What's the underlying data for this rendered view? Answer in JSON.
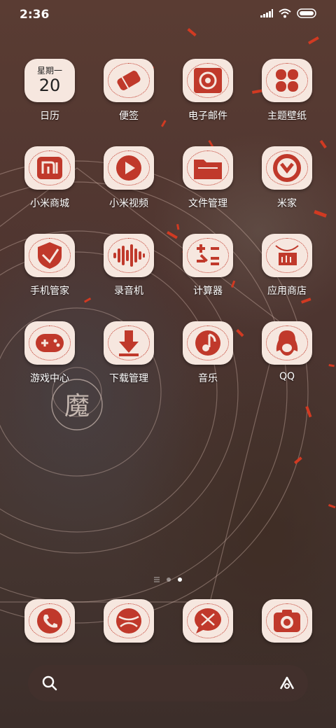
{
  "status": {
    "time": "2:36"
  },
  "calendar": {
    "weekday": "星期一",
    "day": "20"
  },
  "apps": [
    {
      "label": "日历",
      "icon": "calendar-icon"
    },
    {
      "label": "便签",
      "icon": "notes-icon"
    },
    {
      "label": "电子邮件",
      "icon": "email-icon"
    },
    {
      "label": "主题壁纸",
      "icon": "themes-icon"
    },
    {
      "label": "小米商城",
      "icon": "mi-store-icon"
    },
    {
      "label": "小米视频",
      "icon": "video-icon"
    },
    {
      "label": "文件管理",
      "icon": "file-manager-icon"
    },
    {
      "label": "米家",
      "icon": "mijia-icon"
    },
    {
      "label": "手机管家",
      "icon": "security-icon"
    },
    {
      "label": "录音机",
      "icon": "recorder-icon"
    },
    {
      "label": "计算器",
      "icon": "calculator-icon"
    },
    {
      "label": "应用商店",
      "icon": "app-store-icon"
    },
    {
      "label": "游戏中心",
      "icon": "game-center-icon"
    },
    {
      "label": "下载管理",
      "icon": "downloads-icon"
    },
    {
      "label": "音乐",
      "icon": "music-icon"
    },
    {
      "label": "QQ",
      "icon": "qq-icon"
    }
  ],
  "wallpaper": {
    "glyph": "魔"
  },
  "dock": [
    {
      "icon": "phone-icon"
    },
    {
      "icon": "browser-icon"
    },
    {
      "icon": "messages-icon"
    },
    {
      "icon": "camera-icon"
    }
  ],
  "page_indicator": {
    "pages": 2,
    "current": 2
  },
  "colors": {
    "accent": "#c0392b",
    "tile": "#f6e7df"
  }
}
